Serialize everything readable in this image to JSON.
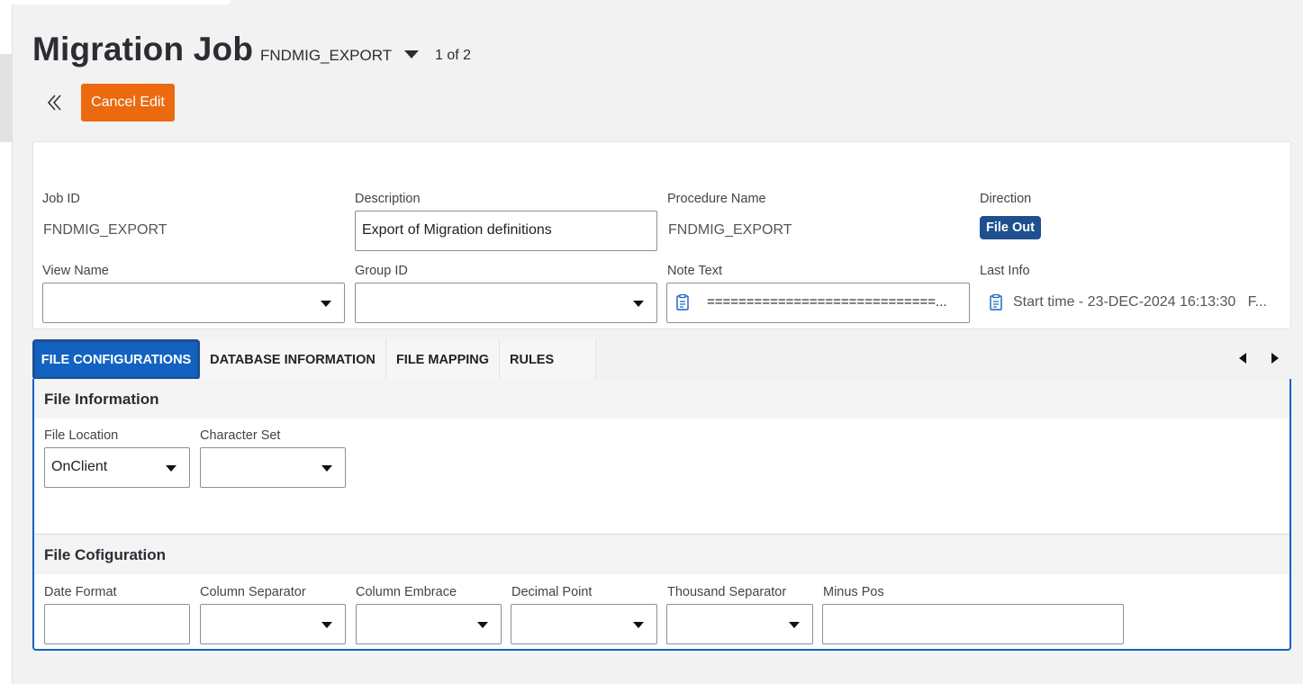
{
  "page": {
    "title": "Migration Job",
    "record_id": "FNDMIG_EXPORT",
    "record_count": "1 of 2"
  },
  "toolbar": {
    "cancel_label": "Cancel Edit"
  },
  "header_form": {
    "job_id_label": "Job ID",
    "job_id_value": "FNDMIG_EXPORT",
    "description_label": "Description",
    "description_value": "Export of Migration definitions",
    "procedure_label": "Procedure Name",
    "procedure_value": "FNDMIG_EXPORT",
    "direction_label": "Direction",
    "direction_value": "File Out",
    "view_name_label": "View Name",
    "group_id_label": "Group ID",
    "note_text_label": "Note Text",
    "note_text_value": "=============================...",
    "last_info_label": "Last Info",
    "last_info_value": "Start time - 23-DEC-2024 16:13:30   F..."
  },
  "tabs": [
    {
      "label": "FILE CONFIGURATIONS",
      "active": true
    },
    {
      "label": "DATABASE INFORMATION",
      "active": false
    },
    {
      "label": "FILE MAPPING",
      "active": false
    },
    {
      "label": "RULES",
      "active": false
    }
  ],
  "file_information": {
    "heading": "File Information",
    "file_location_label": "File Location",
    "file_location_value": "OnClient",
    "character_set_label": "Character Set"
  },
  "file_configuration": {
    "heading": "File Cofiguration",
    "date_format_label": "Date Format",
    "column_separator_label": "Column Separator",
    "column_embrace_label": "Column Embrace",
    "decimal_point_label": "Decimal Point",
    "thousand_separator_label": "Thousand Separator",
    "minus_pos_label": "Minus Pos"
  },
  "colors": {
    "accent": "#eb6a10",
    "tab_active": "#1262c2",
    "badge": "#1f4f8f"
  },
  "icons": [
    "double-chevron-left-icon",
    "chevron-down-icon",
    "note-icon",
    "arrow-left-icon",
    "arrow-right-icon"
  ]
}
